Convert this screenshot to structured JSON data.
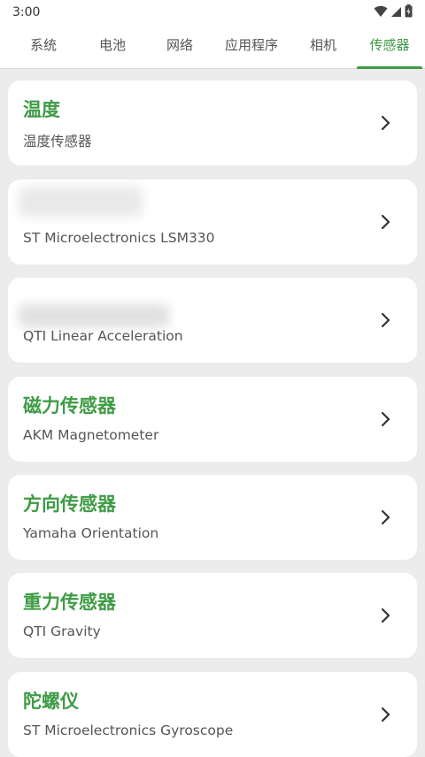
{
  "status": {
    "time": "3:00"
  },
  "tabs": [
    {
      "label": "系统",
      "active": false
    },
    {
      "label": "电池",
      "active": false
    },
    {
      "label": "网络",
      "active": false
    },
    {
      "label": "应用程序",
      "active": false
    },
    {
      "label": "相机",
      "active": false
    },
    {
      "label": "传感器",
      "active": true
    }
  ],
  "sensors": [
    {
      "title": "温度",
      "subtitle": "温度传感器"
    },
    {
      "title": "",
      "subtitle": "ST Microelectronics LSM330"
    },
    {
      "title": "",
      "subtitle": "QTI Linear Acceleration"
    },
    {
      "title": "磁力传感器",
      "subtitle": "AKM Magnetometer"
    },
    {
      "title": "方向传感器",
      "subtitle": "Yamaha Orientation"
    },
    {
      "title": "重力传感器",
      "subtitle": "QTI Gravity"
    },
    {
      "title": "陀螺仪",
      "subtitle": "ST Microelectronics Gyroscope"
    }
  ],
  "colors": {
    "accent": "#3f9b46",
    "background": "#ececec",
    "card": "#ffffff"
  }
}
